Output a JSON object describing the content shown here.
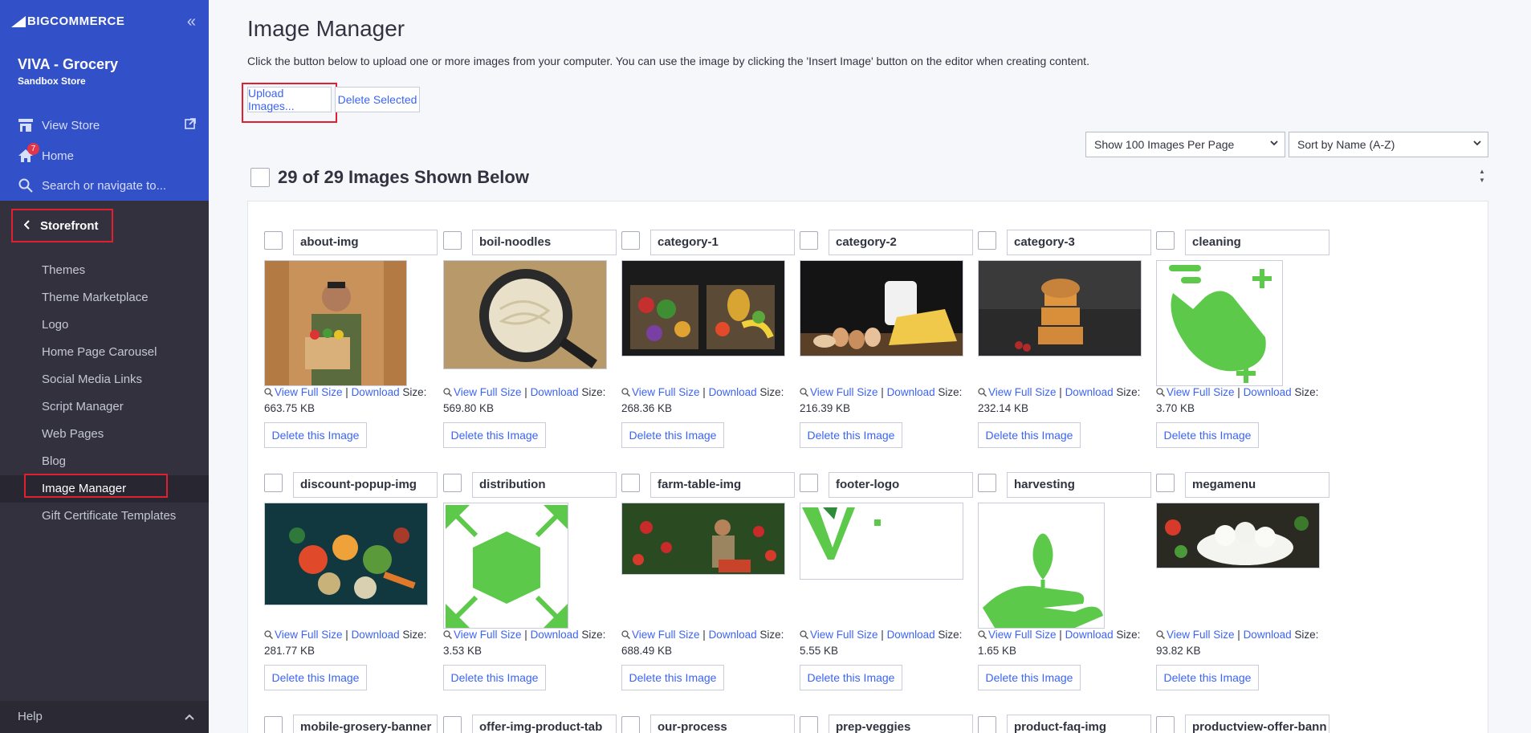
{
  "sidebar": {
    "logo": "BIGCOMMERCE",
    "store_name": "VIVA - Grocery",
    "store_sub": "Sandbox Store",
    "view_store": "View Store",
    "home": "Home",
    "home_badge": "7",
    "search_placeholder": "Search or navigate to...",
    "section": "Storefront",
    "items": [
      {
        "label": "Themes"
      },
      {
        "label": "Theme Marketplace"
      },
      {
        "label": "Logo"
      },
      {
        "label": "Home Page Carousel"
      },
      {
        "label": "Social Media Links"
      },
      {
        "label": "Script Manager"
      },
      {
        "label": "Web Pages"
      },
      {
        "label": "Blog"
      },
      {
        "label": "Image Manager"
      },
      {
        "label": "Gift Certificate Templates"
      }
    ],
    "help": "Help"
  },
  "main": {
    "title": "Image Manager",
    "description": "Click the button below to upload one or more images from your computer. You can use the image by clicking the 'Insert Image' button on the editor when creating content.",
    "upload_label": "Upload Images...",
    "delete_selected_label": "Delete Selected",
    "per_page": "Show 100 Images Per Page",
    "sort": "Sort by Name (A-Z)",
    "count_text": "29 of 29 Images Shown Below",
    "view_full": "View Full Size",
    "download": "Download",
    "size_label": "Size:",
    "delete_label": "Delete this Image",
    "images": [
      {
        "name": "about-img",
        "size": "663.75 KB"
      },
      {
        "name": "boil-noodles",
        "size": "569.80 KB"
      },
      {
        "name": "category-1",
        "size": "268.36 KB"
      },
      {
        "name": "category-2",
        "size": "216.39 KB"
      },
      {
        "name": "category-3",
        "size": "232.14 KB"
      },
      {
        "name": "cleaning",
        "size": "3.70 KB"
      },
      {
        "name": "discount-popup-img",
        "size": "281.77 KB"
      },
      {
        "name": "distribution",
        "size": "3.53 KB"
      },
      {
        "name": "farm-table-img",
        "size": "688.49 KB"
      },
      {
        "name": "footer-logo",
        "size": "5.55 KB"
      },
      {
        "name": "harvesting",
        "size": "1.65 KB"
      },
      {
        "name": "megamenu",
        "size": "93.82 KB"
      },
      {
        "name": "mobile-grosery-banner"
      },
      {
        "name": "offer-img-product-tab"
      },
      {
        "name": "our-process"
      },
      {
        "name": "prep-veggies"
      },
      {
        "name": "product-faq-img"
      },
      {
        "name": "productview-offer-bann"
      }
    ]
  },
  "colors": {
    "sidebar_top": "#3250c7",
    "sidebar": "#34313f",
    "link": "#3c64f4",
    "highlight": "#e0202f",
    "icon_green": "#5cc94a"
  }
}
